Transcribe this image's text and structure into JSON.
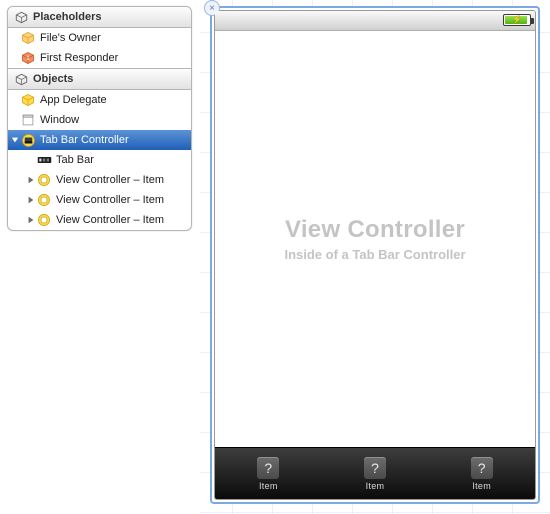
{
  "panel": {
    "sections": [
      {
        "header": "Placeholders",
        "header_icon": "cube-wire",
        "rows": [
          {
            "icon": "cube-orange",
            "label": "File's Owner",
            "indent": 12,
            "disclosure": "",
            "selected": false
          },
          {
            "icon": "cube-red",
            "label": "First Responder",
            "indent": 12,
            "disclosure": "",
            "selected": false
          }
        ]
      },
      {
        "header": "Objects",
        "header_icon": "cube-wire",
        "rows": [
          {
            "icon": "cube-yellow",
            "label": "App Delegate",
            "indent": 12,
            "disclosure": "",
            "selected": false
          },
          {
            "icon": "window",
            "label": "Window",
            "indent": 12,
            "disclosure": "",
            "selected": false
          },
          {
            "icon": "tabctrl",
            "label": "Tab Bar Controller",
            "indent": 2,
            "disclosure": "down",
            "selected": true
          },
          {
            "icon": "tabbar",
            "label": "Tab Bar",
            "indent": 28,
            "disclosure": "",
            "selected": false
          },
          {
            "icon": "vc-yellow",
            "label": "View Controller – Item",
            "indent": 18,
            "disclosure": "right",
            "selected": false
          },
          {
            "icon": "vc-yellow",
            "label": "View Controller – Item",
            "indent": 18,
            "disclosure": "right",
            "selected": false
          },
          {
            "icon": "vc-yellow",
            "label": "View Controller – Item",
            "indent": 18,
            "disclosure": "right",
            "selected": false
          }
        ]
      }
    ]
  },
  "canvas": {
    "close_glyph": "×",
    "battery_bolt": "⚡",
    "vc_title": "View Controller",
    "vc_subtitle": "Inside of a Tab Bar Controller",
    "tab_items": [
      {
        "glyph": "?",
        "label": "Item"
      },
      {
        "glyph": "?",
        "label": "Item"
      },
      {
        "glyph": "?",
        "label": "Item"
      }
    ]
  }
}
